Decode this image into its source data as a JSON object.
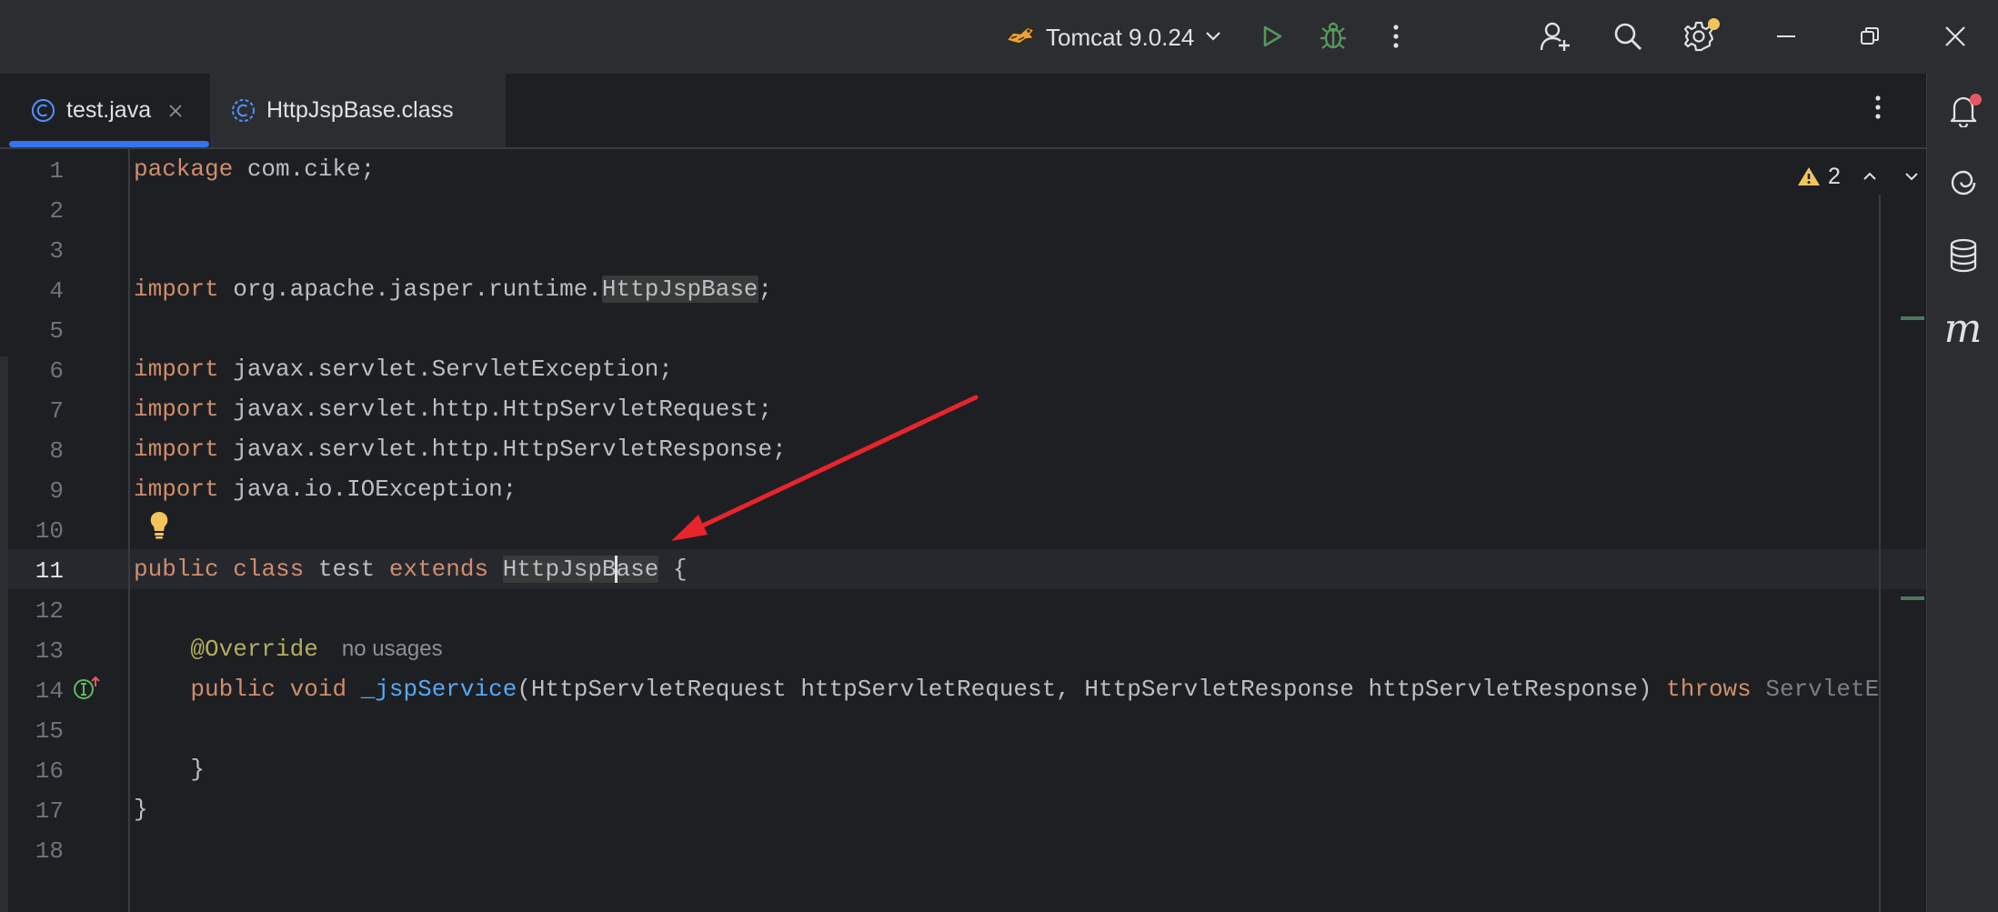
{
  "titlebar": {
    "run_config_label": "Tomcat 9.0.24",
    "icons": [
      "tomcat-icon",
      "chevron-down-icon",
      "run-icon",
      "debug-icon",
      "more-vertical-icon",
      "add-user-icon",
      "search-icon",
      "settings-icon",
      "minimize-icon",
      "restore-icon",
      "close-icon"
    ],
    "colors": {
      "run": "#57965c",
      "debug": "#57965c",
      "settings_badge": "#f2c55c",
      "notification_badge": "#e55765"
    }
  },
  "tabs": [
    {
      "label": "test.java",
      "active": true
    },
    {
      "label": "HttpJspBase.class",
      "active": false
    }
  ],
  "editor": {
    "inspection_count": "2",
    "inlay_hint": "no usages",
    "line_numbers": [
      "1",
      "2",
      "3",
      "4",
      "5",
      "6",
      "7",
      "8",
      "9",
      "10",
      "11",
      "12",
      "13",
      "14",
      "15",
      "16",
      "17",
      "18"
    ],
    "code": {
      "l1_kw": "package",
      "l1_rest": " com.cike;",
      "l4_kw": "import",
      "l4_pkg": " org.apache.jasper.runtime.",
      "l4_cls": "HttpJspBase",
      "l4_end": ";",
      "l6_kw": "import",
      "l6_rest": " javax.servlet.ServletException;",
      "l7_kw": "import",
      "l7_rest": " javax.servlet.http.HttpServletRequest;",
      "l8_kw": "import",
      "l8_rest": " javax.servlet.http.HttpServletResponse;",
      "l9_kw": "import",
      "l9_rest": " java.io.IOException;",
      "l11_kw1": "public",
      "l11_kw2": "class",
      "l11_name": " test ",
      "l11_kw3": "extends",
      "l11_cls_a": "HttpJspB",
      "l11_cls_b": "ase",
      "l11_end": " {",
      "l13_ann": "@Override",
      "l14_kw1": "public",
      "l14_kw2": "void",
      "l14_fn": "_jspService",
      "l14_params": "(HttpServletRequest httpServletRequest, HttpServletResponse httpServletResponse) ",
      "l14_throws": "throws",
      "l14_exc": " ServletE",
      "l16": "    }",
      "l17": "}"
    }
  },
  "rightstrip": {
    "icons": [
      "notifications-icon",
      "ai-assistant-icon",
      "database-icon",
      "maven-icon"
    ],
    "maven_letter": "m"
  }
}
